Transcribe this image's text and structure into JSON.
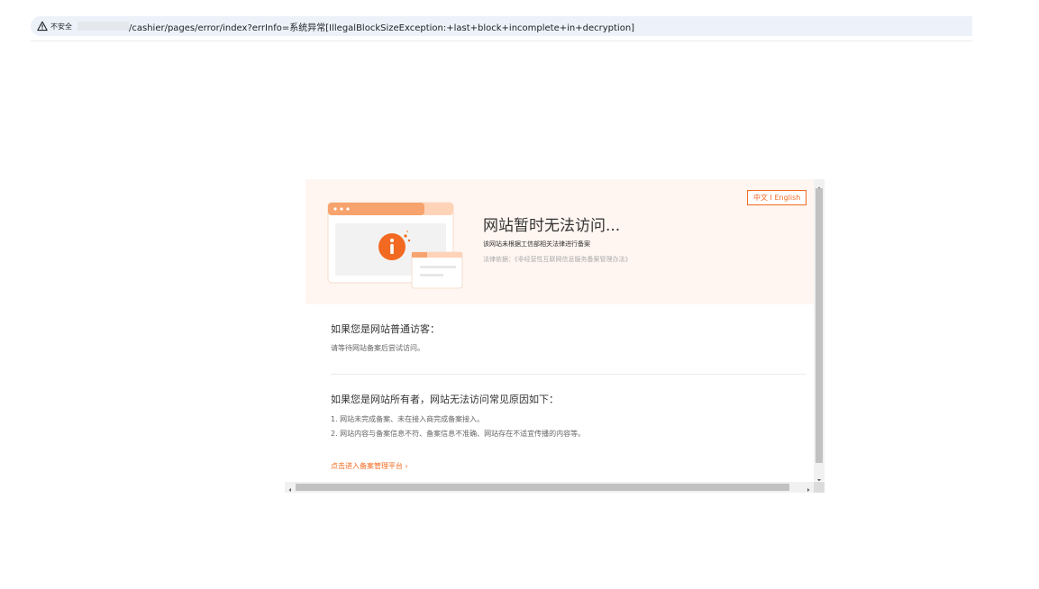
{
  "address_bar": {
    "security_label": "不安全",
    "url_path": "/cashier/pages/error/index?errInfo=系统异常[IllegalBlockSizeException:+last+block+incomplete+in+decryption]"
  },
  "page": {
    "lang_switch": "中文 I English",
    "title": "网站暂时无法访问...",
    "description": "该网站未根据工信部相关法律进行备案",
    "legal_basis": "法律依据：《非经营性互联网信息服务备案管理办法》",
    "visitor_title": "如果您是网站普通访客：",
    "visitor_text": "请等待网站备案后尝试访问。",
    "owner_title": "如果您是网站所有者，网站无法访问常见原因如下：",
    "owner_reasons": [
      "1. 网站未完成备案、未在接入商完成备案接入。",
      "2. 网站内容与备案信息不符、备案信息不准确、网站存在不适宜传播的内容等。"
    ],
    "platform_link": "点击进入备案管理平台 ›"
  },
  "icons": [
    "warning-triangle-icon",
    "info-icon",
    "scroll-arrow-icons"
  ],
  "colors": {
    "accent": "#f26a21",
    "hero_bg": "#fff6f1",
    "address_bg": "#edf2fa"
  }
}
